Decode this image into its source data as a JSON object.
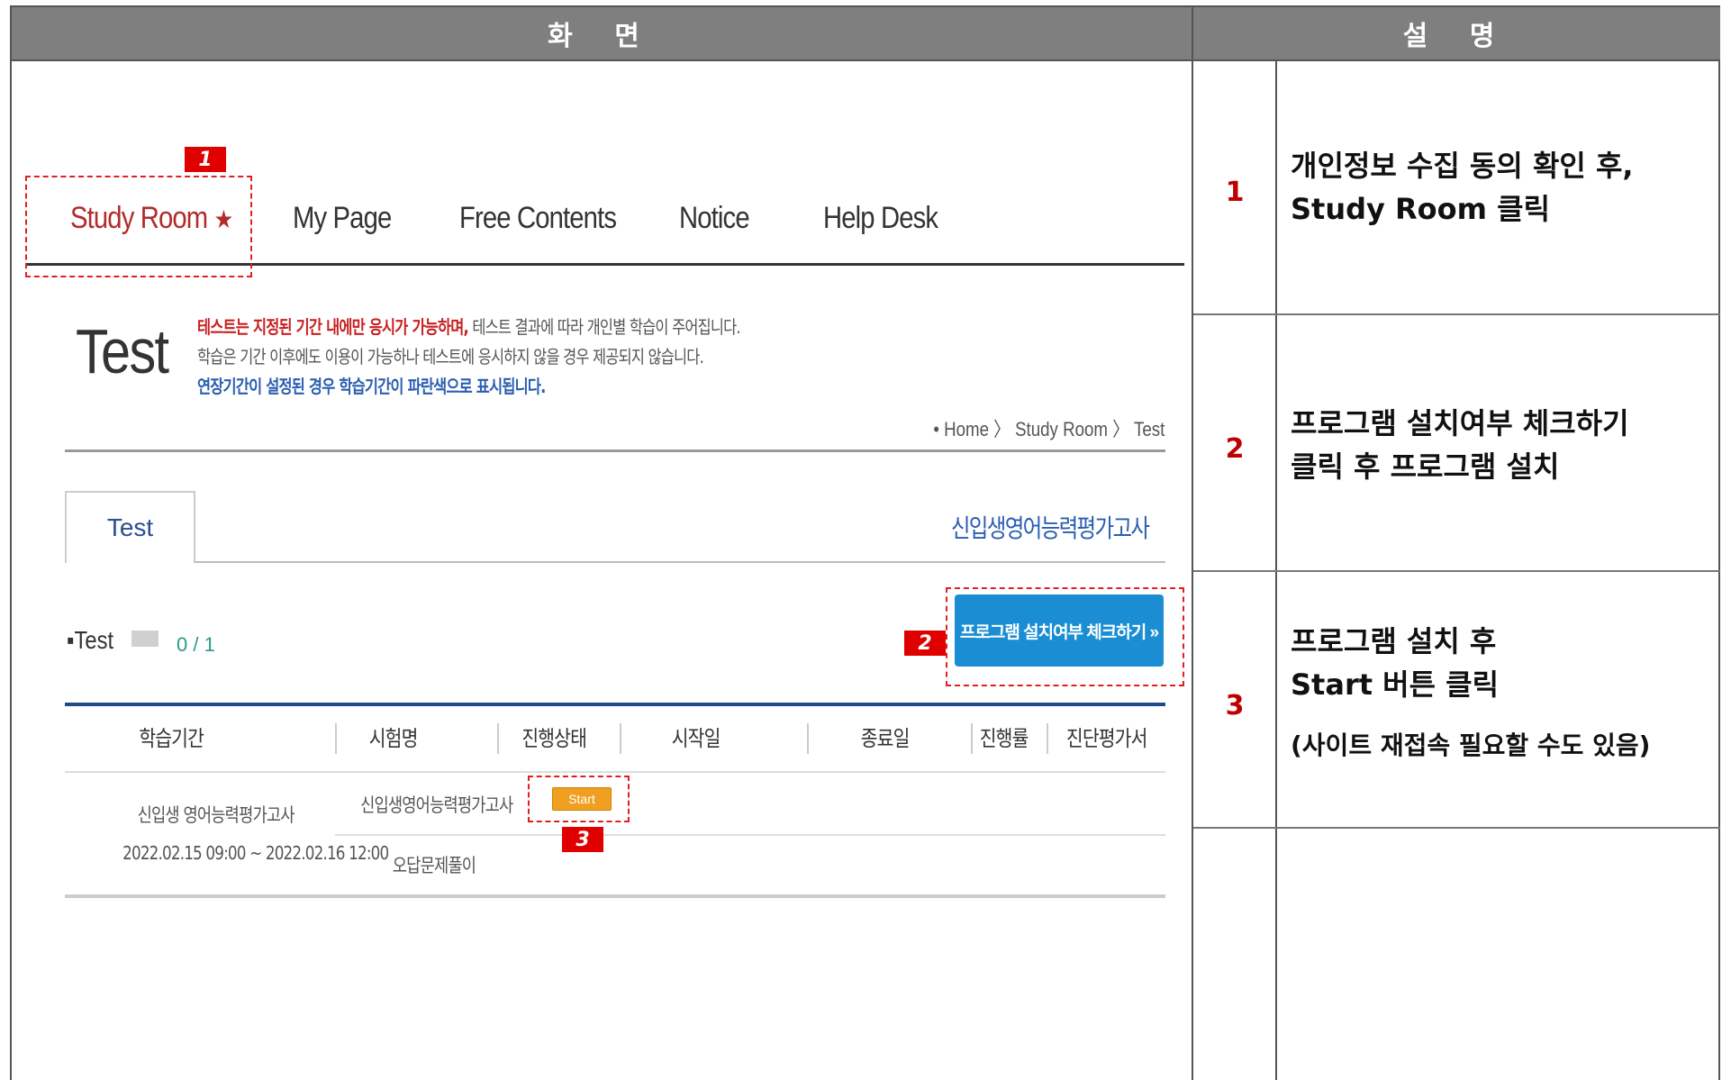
{
  "header": {
    "screen": "화 면",
    "description": "설 명"
  },
  "steps": [
    {
      "num": "1",
      "lines": [
        "개인정보 수집 동의 확인 후,",
        "Study Room 클릭"
      ]
    },
    {
      "num": "2",
      "lines": [
        "프로그램 설치여부 체크하기",
        "클릭 후 프로그램 설치"
      ]
    },
    {
      "num": "3",
      "lines": [
        "프로그램 설치 후",
        "Start 버튼 클릭"
      ],
      "note": "(사이트 재접속 필요할 수도 있음)"
    }
  ],
  "nav": {
    "items": [
      "Study Room",
      "My Page",
      "Free Contents",
      "Notice",
      "Help Desk"
    ],
    "active_star": "★"
  },
  "page": {
    "title": "Test",
    "notice": {
      "line1_red": "테스트는 지정된 기간 내에만 응시가 가능하며,",
      "line1_rest": " 테스트 결과에 따라 개인별 학습이 주어집니다.",
      "line2": "학습은 기간 이후에도 이용이 가능하나 테스트에 응시하지 않을 경우 제공되지 않습니다.",
      "line3_blue": "연장기간이 설정된 경우 학습기간이 파란색으로 표시됩니다."
    },
    "breadcrumb": "• Home 〉 Study Room 〉 Test",
    "tab_label": "Test",
    "course_title": "신입생영어능력평가고사",
    "test_label": "Test",
    "progress": {
      "text": "0 / 1",
      "fraction": 0
    },
    "check_button": "프로그램 설치여부 체크하기 »",
    "table": {
      "headers": [
        "학습기간",
        "시험명",
        "진행상태",
        "시작일",
        "종료일",
        "진행률",
        "진단평가서"
      ],
      "period_name": "신입생 영어능력평가고사",
      "period_dates": "2022.02.15 09:00 ~ 2022.02.16 12:00",
      "row1_name": "신입생영어능력평가고사",
      "row1_status": "Start",
      "row2_name": "오답문제풀이"
    }
  },
  "markers": [
    "1",
    "2",
    "3"
  ],
  "colors": {
    "header_bg": "#7f7f7f",
    "marker": "#e00000",
    "active_nav": "#b22b2b",
    "check_button": "#1b8ed3",
    "start_button": "#f0a020"
  }
}
